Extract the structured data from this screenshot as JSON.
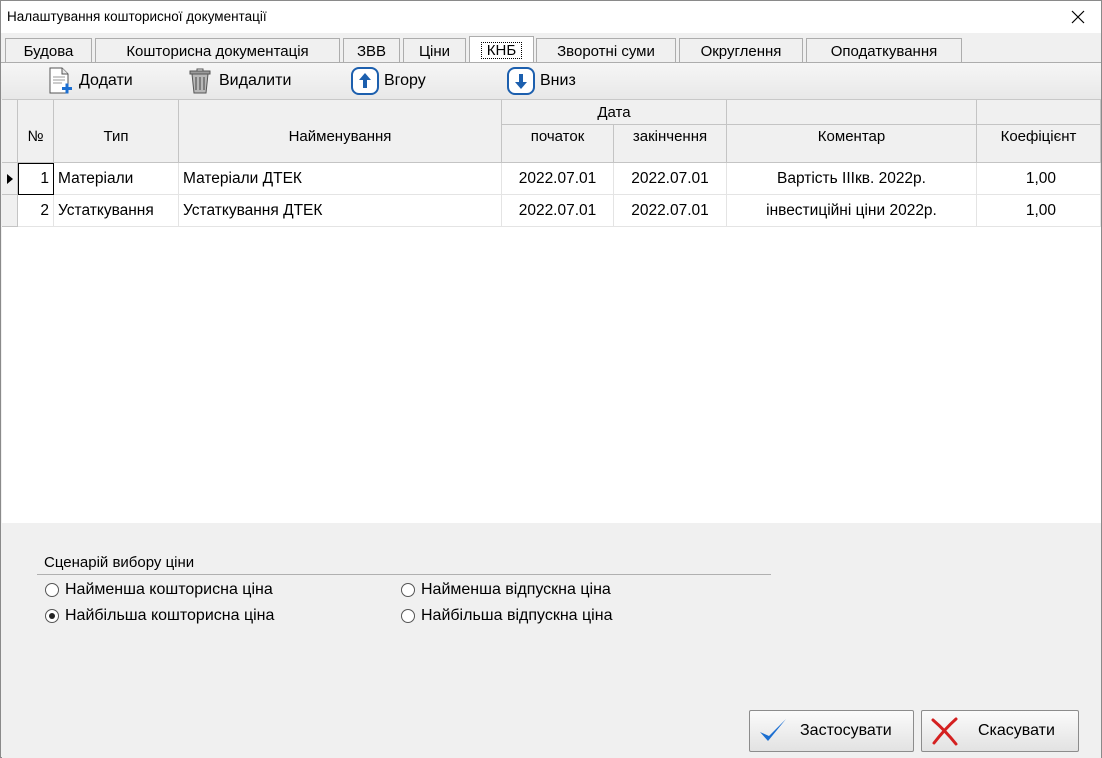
{
  "window": {
    "title": "Налаштування кошторисної документації"
  },
  "tabs": [
    {
      "label": "Будова"
    },
    {
      "label": "Кошторисна документація"
    },
    {
      "label": "ЗВВ"
    },
    {
      "label": "Ціни"
    },
    {
      "label": "КНБ"
    },
    {
      "label": "Зворотні суми"
    },
    {
      "label": "Округлення"
    },
    {
      "label": "Оподаткування"
    }
  ],
  "active_tab": "КНБ",
  "toolbar": {
    "add_label": "Додати",
    "delete_label": "Видалити",
    "up_label": "Вгору",
    "down_label": "Вниз"
  },
  "grid": {
    "headers": {
      "number": "№",
      "type": "Тип",
      "name": "Найменування",
      "date_group": "Дата",
      "start": "початок",
      "end": "закінчення",
      "comment": "Коментар",
      "coef": "Коефіцієнт"
    },
    "rows": [
      {
        "no": "1",
        "type": "Матеріали",
        "name": "Матеріали ДТЕК",
        "start": "2022.07.01",
        "end": "2022.07.01",
        "comment": "Вартість IIIкв. 2022р.",
        "coef": "1,00",
        "selected": true
      },
      {
        "no": "2",
        "type": "Устаткування",
        "name": "Устаткування ДТЕК",
        "start": "2022.07.01",
        "end": "2022.07.01",
        "comment": "інвестиційні ціни 2022р.",
        "coef": "1,00",
        "selected": false
      }
    ]
  },
  "price_scenario": {
    "title": "Сценарій вибору ціни",
    "options": [
      {
        "label": "Найменша кошторисна ціна",
        "checked": false
      },
      {
        "label": "Найменша відпускна ціна",
        "checked": false
      },
      {
        "label": "Найбільша кошторисна ціна",
        "checked": true
      },
      {
        "label": "Найбільша відпускна ціна",
        "checked": false
      }
    ]
  },
  "buttons": {
    "apply_label": "Застосувати",
    "cancel_label": "Скасувати"
  },
  "colors": {
    "accent_blue": "#1c6fd1",
    "cancel_red": "#d42020"
  }
}
